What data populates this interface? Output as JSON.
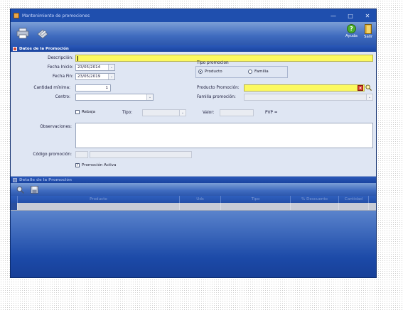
{
  "window": {
    "title": "Mantenimiento de promociones",
    "controls": [
      "minimize",
      "maximize",
      "close"
    ]
  },
  "toolbar": {
    "help_label": "Ayuda",
    "exit_label": "Salir"
  },
  "promotion_section": {
    "header": "Datos de la Promoción",
    "descripcion_label": "Descripción:",
    "descripcion_value": "",
    "fecha_inicio_label": "Fecha Inicio:",
    "fecha_inicio_value": "23/05/2014",
    "fecha_fin_label": "Fecha Fin:",
    "fecha_fin_value": "23/05/2019",
    "tipo_promocion_label": "Tipo promocion",
    "tipo_options": [
      "Producto",
      "Familia"
    ],
    "tipo_selected": "Producto",
    "cantidad_minima_label": "Cantidad mínima:",
    "cantidad_minima_value": "1",
    "producto_promocion_label": "Producto Promoción:",
    "producto_promocion_value": "",
    "centro_label": "Centro:",
    "centro_value": "",
    "familia_promocion_label": "Familia promoción:",
    "familia_promocion_value": "",
    "rebaja_label": "Rebaja",
    "rebaja_checked": false,
    "tipo_label": "Tipo:",
    "tipo_value": "",
    "valor_label": "Valor:",
    "valor_value": "",
    "pvp_label": "PVP =",
    "observaciones_label": "Observaciones:",
    "observaciones_value": "",
    "codigo_promocion_label": "Código promoción:",
    "codigo_promocion_prefix": "",
    "codigo_promocion_value": "",
    "promocion_activa_label": "Promoción Activa",
    "promocion_activa_checked": true
  },
  "detail_section": {
    "header": "Detalle de la Promoción",
    "columns": [
      "Producto",
      "Uds",
      "Tipo",
      "% Descuento",
      "Cantidad"
    ]
  },
  "colors": {
    "window_blue": "#1a49a8",
    "form_bg": "#dfe6f3",
    "required_yellow": "#fcf95f"
  }
}
